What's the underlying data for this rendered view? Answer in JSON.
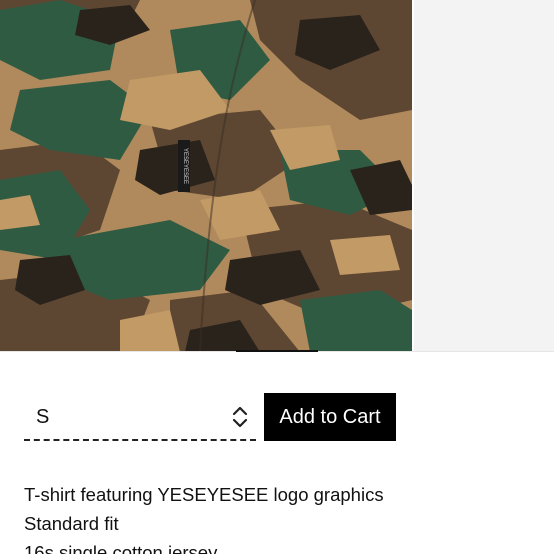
{
  "product": {
    "image_alt": "Camouflage T-shirt close-up",
    "neck_tag_text": "YESEYESEE"
  },
  "purchase": {
    "size_selected": "S",
    "select_icon": "up-down-chevron-icon",
    "add_to_cart_label": "Add to Cart"
  },
  "description": {
    "lines": [
      "T-shirt featuring YESEYESEE logo graphics",
      "Standard fit",
      "16s single cotton jersey"
    ]
  },
  "colors": {
    "camo_tan": "#b8905e",
    "camo_brown": "#5f4a35",
    "camo_green": "#2e5a42",
    "camo_dark": "#2a231c",
    "cart_button": "#000000"
  }
}
